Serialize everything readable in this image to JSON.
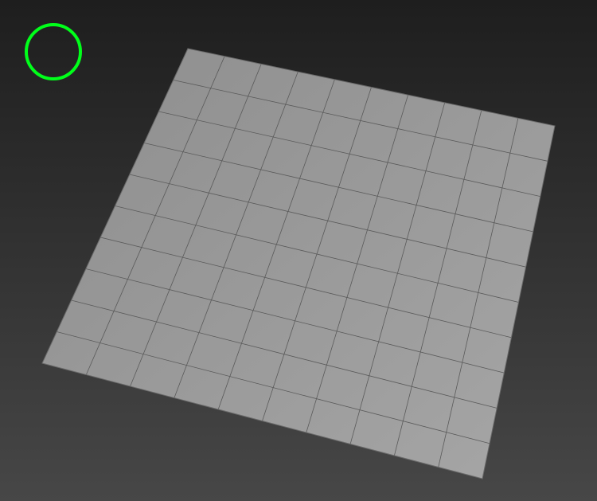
{
  "viewport": {
    "background_top": "#1e1e1e",
    "background_bottom": "#474747"
  },
  "plane": {
    "subdivisions_u": 10,
    "subdivisions_v": 10,
    "face_color": "#9a9a9a",
    "face_color_light": "#a3a3a3",
    "wire_color": "#5a5a5a"
  },
  "gizmo": {
    "icon": "circle-gizmo-icon",
    "color": "#00ff1a"
  }
}
